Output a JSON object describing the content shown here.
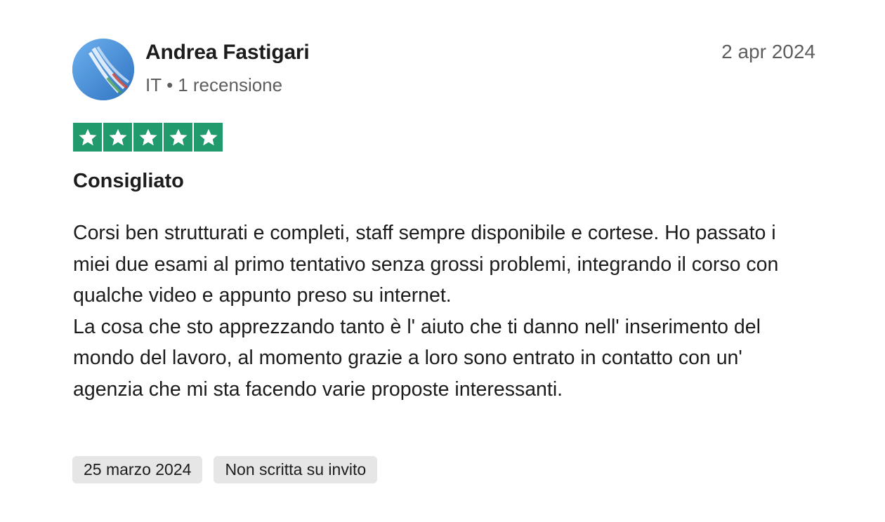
{
  "reviewer": {
    "name": "Andrea Fastigari",
    "country": "IT",
    "separator": "•",
    "review_count": "1 recensione",
    "avatar_icon": "avatar-photo-icon"
  },
  "review": {
    "date": "2 apr 2024",
    "rating": 5,
    "rating_max": 5,
    "star_color": "#219a6e",
    "title": "Consigliato",
    "paragraphs": [
      "Corsi ben strutturati e completi, staff sempre disponibile e cortese. Ho passato i miei due esami al primo tentativo senza grossi problemi, integrando il corso con qualche video e appunto preso su internet.",
      "La cosa che sto apprezzando tanto è l' aiuto che ti danno nell' inserimento del mondo del lavoro, al momento grazie a loro sono entrato in contatto con un' agenzia che mi sta facendo varie proposte interessanti."
    ],
    "tags": [
      "25 marzo 2024",
      "Non scritta su invito"
    ]
  }
}
